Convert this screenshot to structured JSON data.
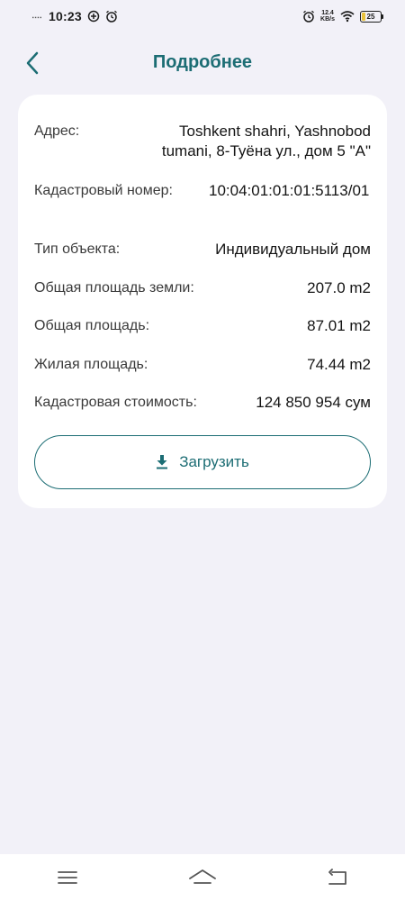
{
  "status_bar": {
    "time": "10:23",
    "net_speed_value": "12.4",
    "net_speed_unit": "KB/s",
    "battery_percent": "25",
    "battery_level": 0.25,
    "battery_color": "#e9c23b"
  },
  "header": {
    "title": "Подробнее",
    "accent_color": "#1c6d74"
  },
  "details": {
    "address_label": "Адрес:",
    "address_value": "Toshkent shahri, Yashnobod tumani, 8-Туёна ул., дом 5 \"А\"",
    "cadastre_label": "Кадастровый номер:",
    "cadastre_value": "10:04:01:01:01:5113/01",
    "type_label": "Тип объекта:",
    "type_value": "Индивидуальный дом",
    "land_area_label": "Общая площадь земли:",
    "land_area_value": "207.0 m2",
    "total_area_label": "Общая площадь:",
    "total_area_value": "87.01 m2",
    "living_area_label": "Жилая площадь:",
    "living_area_value": "74.44 m2",
    "cost_label": "Кадастровая стоимость:",
    "cost_value": "124 850 954 сум"
  },
  "download": {
    "label": "Загрузить",
    "icon": "download-icon"
  },
  "nav": {
    "menu_icon": "menu-icon",
    "home_icon": "home-icon",
    "back_icon": "back-icon"
  }
}
